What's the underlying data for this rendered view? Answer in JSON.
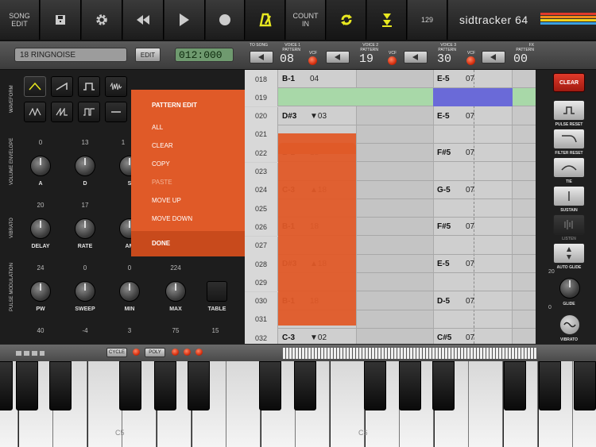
{
  "topbar": {
    "song_edit": "SONG\nEDIT",
    "count_in": "COUNT\nIN",
    "tempo": "129",
    "brand": "sidtracker 64",
    "brand_stripes": [
      "#e23a2a",
      "#f08a1a",
      "#f2d21a",
      "#3aa0e0",
      "#8a8a8a"
    ]
  },
  "transport": {
    "instrument_name": "18  RINGNOISE",
    "edit_label": "EDIT",
    "time": "012:000",
    "to_song": "TO SONG",
    "voices": [
      {
        "label": "VOICE 1\nPATTERN",
        "vcf": "VCF",
        "value": "08"
      },
      {
        "label": "VOICE 2\nPATTERN",
        "vcf": "VCF",
        "value": "19"
      },
      {
        "label": "VOICE 3\nPATTERN",
        "vcf": "VCF",
        "value": "30"
      },
      {
        "label": "FX\nPATTERN",
        "vcf": "",
        "value": "00"
      }
    ]
  },
  "left": {
    "sections": {
      "waveform": "WAVEFORM",
      "volume_envelope": "VOLUME ENVELOPE",
      "vibrato": "VIBRATO",
      "pulse_modulation": "PULSE MODULATION"
    },
    "env_knobs": [
      {
        "value": "0",
        "label": "A"
      },
      {
        "value": "13",
        "label": "D"
      },
      {
        "value": "1",
        "label": "S"
      }
    ],
    "vib_knobs": [
      {
        "value": "20",
        "label": "DELAY"
      },
      {
        "value": "17",
        "label": "RATE"
      },
      {
        "value": "",
        "label": "AM"
      }
    ],
    "pulse_knobs": [
      {
        "value": "24",
        "label": "PW"
      },
      {
        "value": "0",
        "label": "SWEEP"
      },
      {
        "value": "0",
        "label": "MIN"
      },
      {
        "value": "224",
        "label": "MAX"
      }
    ],
    "table_label": "TABLE",
    "bottom_values": [
      "40",
      "-4",
      "3",
      "75",
      "15"
    ]
  },
  "popup": {
    "title": "PATTERN EDIT",
    "items": [
      "ALL",
      "CLEAR",
      "COPY",
      "PASTE",
      "MOVE UP",
      "MOVE DOWN"
    ],
    "done": "DONE"
  },
  "grid": {
    "rows": [
      {
        "num": "018",
        "v1n": "B-1",
        "v1i": "04",
        "v3n": "E-5",
        "v3i": "07"
      },
      {
        "num": "019",
        "v1n": "",
        "v1i": "",
        "v3n": "",
        "v3i": ""
      },
      {
        "num": "020",
        "v1n": "D#3",
        "v1i": "▼03",
        "v3n": "E-5",
        "v3i": "07"
      },
      {
        "num": "021",
        "v1n": "",
        "v1i": "",
        "v3n": "",
        "v3i": ""
      },
      {
        "num": "022",
        "v1n": "B-1",
        "v1i": "18",
        "v3n": "F#5",
        "v3i": "07"
      },
      {
        "num": "023",
        "v1n": "",
        "v1i": "",
        "v3n": "",
        "v3i": ""
      },
      {
        "num": "024",
        "v1n": "C-3",
        "v1i": "▲18",
        "v3n": "G-5",
        "v3i": "07"
      },
      {
        "num": "025",
        "v1n": "",
        "v1i": "",
        "v3n": "",
        "v3i": ""
      },
      {
        "num": "026",
        "v1n": "B-1",
        "v1i": "18",
        "v3n": "F#5",
        "v3i": "07"
      },
      {
        "num": "027",
        "v1n": "",
        "v1i": "",
        "v3n": "",
        "v3i": ""
      },
      {
        "num": "028",
        "v1n": "D#3",
        "v1i": "▲18",
        "v3n": "E-5",
        "v3i": "07"
      },
      {
        "num": "029",
        "v1n": "",
        "v1i": "",
        "v3n": "",
        "v3i": ""
      },
      {
        "num": "030",
        "v1n": "B-1",
        "v1i": "18",
        "v3n": "D-5",
        "v3i": "07"
      },
      {
        "num": "031",
        "v1n": "",
        "v1i": "",
        "v3n": "",
        "v3i": ""
      },
      {
        "num": "032",
        "v1n": "C-3",
        "v1i": "▼02",
        "v3n": "C#5",
        "v3i": "07"
      }
    ],
    "highlight_color": "#a8d8a8",
    "cursor_color": "#6a6ad8",
    "block_color": "#e05a28"
  },
  "right": {
    "clear": "CLEAR",
    "labels": [
      "PULSE RESET",
      "FILTER RESET",
      "TIE",
      "SUSTAIN",
      "LISTEN",
      "AUTO GLIDE"
    ],
    "glide_max": "20",
    "glide_min": "0",
    "glide": "GLIDE",
    "vibrato": "VIBRATO"
  },
  "keyboard": {
    "cycle": "CYCLE",
    "poly": "POLY",
    "c5": "C5",
    "c6": "C6"
  }
}
